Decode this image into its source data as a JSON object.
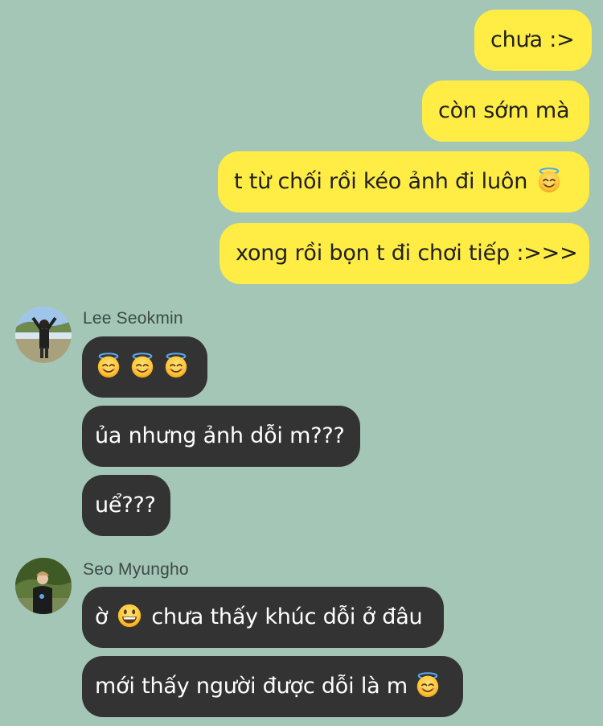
{
  "outgoing": [
    {
      "text": "chưa :>",
      "emoji_after": null
    },
    {
      "text": "còn sớm mà",
      "emoji_after": null
    },
    {
      "text": "t từ chối rồi kéo ảnh đi luôn",
      "emoji_after": "halo-smile-emoji"
    },
    {
      "text": "xong rồi bọn t đi chơi tiếp :>>>",
      "emoji_after": null
    }
  ],
  "groups": [
    {
      "sender": "Lee Seokmin",
      "avatar_icon": "avatar-lee-seokmin",
      "messages": [
        {
          "text": "",
          "emojis": [
            "halo-smile-emoji",
            "halo-smile-emoji",
            "halo-smile-emoji"
          ]
        },
        {
          "text": "ủa nhưng ảnh dỗi m???"
        },
        {
          "text": "uể???"
        }
      ]
    },
    {
      "sender": "Seo Myungho",
      "avatar_icon": "avatar-seo-myungho",
      "messages": [
        {
          "text_before": "ờ",
          "emoji": "grin-emoji",
          "text_after": "chưa thấy khúc dỗi ở đâu"
        },
        {
          "text": "mới thấy người được dỗi là m",
          "emoji_after": "halo-smile-emoji"
        }
      ]
    }
  ],
  "colors": {
    "background": "#a3c6b7",
    "outgoing_bubble": "#ffec44",
    "incoming_bubble": "#333333",
    "incoming_text": "#ffffff",
    "outgoing_text": "#202020"
  }
}
